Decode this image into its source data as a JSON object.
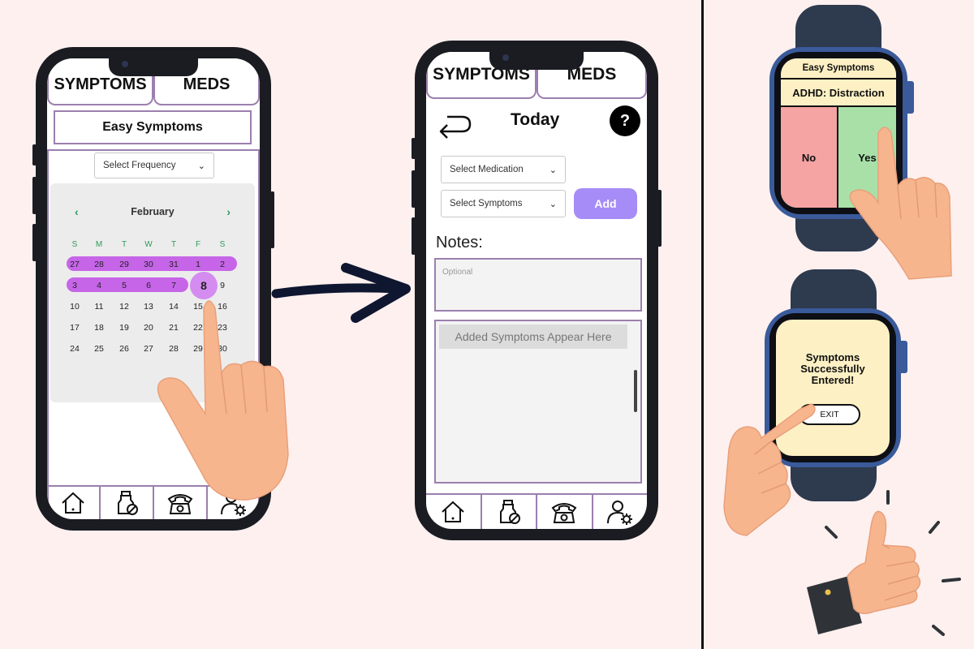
{
  "phone1": {
    "tabs": [
      "SYMPTOMS",
      "MEDS"
    ],
    "app_title": "Easy Symptoms",
    "frequency_select": "Select Frequency",
    "calendar": {
      "month": "February",
      "prev_icon": "‹",
      "next_icon": "›",
      "weekdays": [
        "S",
        "M",
        "T",
        "W",
        "T",
        "F",
        "S"
      ],
      "weeks": [
        [
          "27",
          "28",
          "29",
          "30",
          "31",
          "1",
          "2"
        ],
        [
          "3",
          "4",
          "5",
          "6",
          "7",
          "8",
          "9"
        ],
        [
          "10",
          "11",
          "12",
          "13",
          "14",
          "15",
          "16"
        ],
        [
          "17",
          "18",
          "19",
          "20",
          "21",
          "22",
          "23"
        ],
        [
          "24",
          "25",
          "26",
          "27",
          "28",
          "29",
          "30"
        ]
      ],
      "selected_day": "8",
      "highlight_color": "#c665e8"
    }
  },
  "phone2": {
    "tabs": [
      "SYMPTOMS",
      "MEDS"
    ],
    "title": "Today",
    "help_label": "?",
    "medication_select": "Select Medication",
    "symptoms_select": "Select Symptoms",
    "add_label": "Add",
    "notes_label": "Notes:",
    "notes_placeholder": "Optional",
    "list_header": "Added Symptoms Appear Here",
    "accent_color": "#a68cf7"
  },
  "bottom_nav_icons": [
    "home-icon",
    "pill-bottle-icon",
    "telephone-icon",
    "user-settings-icon"
  ],
  "watch1": {
    "title": "Easy Symptoms",
    "question": "ADHD: Distraction",
    "no_label": "No",
    "yes_label": "Yes"
  },
  "watch2": {
    "message_lines": [
      "Symptoms",
      "Successfully",
      "Entered!"
    ],
    "exit_label": "EXIT"
  }
}
